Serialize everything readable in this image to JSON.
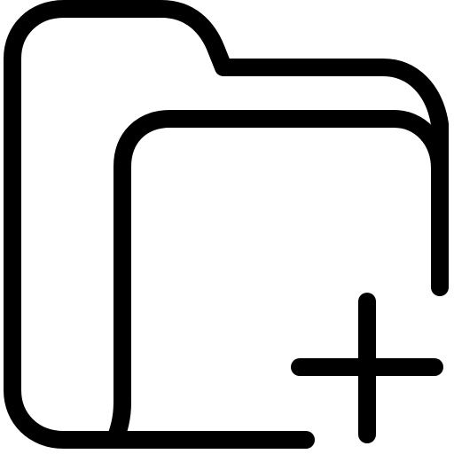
{
  "icon": {
    "name": "folder-add-icon",
    "stroke_color": "#000000",
    "background_color": "#ffffff"
  }
}
